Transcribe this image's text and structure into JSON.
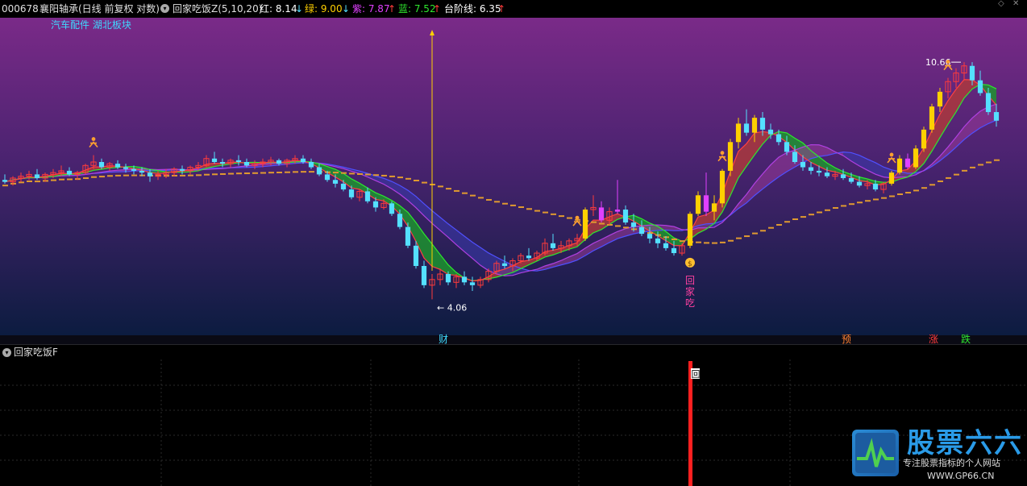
{
  "header": {
    "stock_code": "000678",
    "stock_name": "襄阳轴承",
    "period": "(日线 前复权 对数)",
    "indicator": "回家吃饭Z(5,10,20)",
    "red_label": "红: 8.14",
    "red_arrow": "↓",
    "green_label": "绿: 9.00",
    "green_arrow": "↓",
    "purple_label": "紫: 7.87",
    "purple_arrow": "↑",
    "blue_label": "蓝: 7.52",
    "blue_arrow": "↑",
    "step_label": "台阶线: 6.35",
    "step_arrow": "↑"
  },
  "sectors": "汽车配件 湖北板块",
  "sub_panel": {
    "title": "回家吃饭F",
    "mark": "回"
  },
  "watermark": {
    "title": "股票六六",
    "subtitle": "专注股票指标的个人网站",
    "url": "WWW.GP66.CN"
  },
  "colors": {
    "up": "#ff3b3b",
    "down": "#54e0ff",
    "yellow": "#ffd000",
    "magenta": "#e040ff",
    "green_line": "#2ee82e",
    "red_line": "#ff4040",
    "purple_line": "#b040e0",
    "blue_line": "#5050ff",
    "step": "#e09a30"
  },
  "chart_data": {
    "type": "candlestick",
    "scale": "log",
    "ylim": [
      3.6,
      12.2
    ],
    "max_label": "10.66",
    "min_label": "4.06",
    "annotations": {
      "signal_text": [
        "回",
        "家",
        "吃"
      ],
      "bottom_labels": [
        "财",
        "预",
        "涨",
        "跌"
      ]
    },
    "candles": [
      [
        6.6,
        6.75,
        6.5,
        6.55
      ],
      [
        6.55,
        6.7,
        6.45,
        6.65
      ],
      [
        6.65,
        6.8,
        6.55,
        6.7
      ],
      [
        6.7,
        6.85,
        6.6,
        6.75
      ],
      [
        6.75,
        6.9,
        6.6,
        6.65
      ],
      [
        6.65,
        6.8,
        6.55,
        6.75
      ],
      [
        6.75,
        6.9,
        6.65,
        6.8
      ],
      [
        6.8,
        7.0,
        6.7,
        6.85
      ],
      [
        6.85,
        6.95,
        6.7,
        6.75
      ],
      [
        6.75,
        6.85,
        6.6,
        6.8
      ],
      [
        6.8,
        7.05,
        6.75,
        7.0
      ],
      [
        7.0,
        7.3,
        6.9,
        7.1
      ],
      [
        7.1,
        7.2,
        6.9,
        6.95
      ],
      [
        6.95,
        7.1,
        6.85,
        7.05
      ],
      [
        7.05,
        7.15,
        6.9,
        6.95
      ],
      [
        6.95,
        7.05,
        6.8,
        6.9
      ],
      [
        6.9,
        7.0,
        6.75,
        6.85
      ],
      [
        6.85,
        6.95,
        6.7,
        6.8
      ],
      [
        6.8,
        6.9,
        6.55,
        6.7
      ],
      [
        6.7,
        6.85,
        6.6,
        6.75
      ],
      [
        6.75,
        6.9,
        6.65,
        6.8
      ],
      [
        6.8,
        6.95,
        6.7,
        6.9
      ],
      [
        6.9,
        7.0,
        6.75,
        6.85
      ],
      [
        6.85,
        7.0,
        6.75,
        6.95
      ],
      [
        6.95,
        7.1,
        6.85,
        7.0
      ],
      [
        7.0,
        7.3,
        6.95,
        7.2
      ],
      [
        7.2,
        7.4,
        7.05,
        7.1
      ],
      [
        7.1,
        7.2,
        6.95,
        7.05
      ],
      [
        7.05,
        7.2,
        6.95,
        7.15
      ],
      [
        7.15,
        7.3,
        7.0,
        7.1
      ],
      [
        7.1,
        7.2,
        6.95,
        7.0
      ],
      [
        7.0,
        7.15,
        6.9,
        7.05
      ],
      [
        7.05,
        7.2,
        6.95,
        7.1
      ],
      [
        7.1,
        7.25,
        7.0,
        7.15
      ],
      [
        7.15,
        7.2,
        7.0,
        7.05
      ],
      [
        7.05,
        7.2,
        6.95,
        7.15
      ],
      [
        7.15,
        7.3,
        7.05,
        7.2
      ],
      [
        7.2,
        7.3,
        7.05,
        7.1
      ],
      [
        7.1,
        7.2,
        6.9,
        6.95
      ],
      [
        6.95,
        7.05,
        6.7,
        6.75
      ],
      [
        6.75,
        6.85,
        6.55,
        6.6
      ],
      [
        6.6,
        6.75,
        6.4,
        6.5
      ],
      [
        6.5,
        6.6,
        6.3,
        6.35
      ],
      [
        6.35,
        6.45,
        6.1,
        6.15
      ],
      [
        6.15,
        6.35,
        6.05,
        6.3
      ],
      [
        6.3,
        6.4,
        6.0,
        6.05
      ],
      [
        6.05,
        6.15,
        5.8,
        5.9
      ],
      [
        5.9,
        6.1,
        5.85,
        6.0
      ],
      [
        6.0,
        6.05,
        5.7,
        5.75
      ],
      [
        5.75,
        5.85,
        5.4,
        5.45
      ],
      [
        5.45,
        5.55,
        5.0,
        5.05
      ],
      [
        5.05,
        5.15,
        4.6,
        4.65
      ],
      [
        4.65,
        4.75,
        4.25,
        4.3
      ],
      [
        4.3,
        4.5,
        4.06,
        4.4
      ],
      [
        4.4,
        4.6,
        4.3,
        4.5
      ],
      [
        4.5,
        4.55,
        4.3,
        4.35
      ],
      [
        4.35,
        4.5,
        4.25,
        4.45
      ],
      [
        4.45,
        4.55,
        4.3,
        4.35
      ],
      [
        4.35,
        4.45,
        4.2,
        4.3
      ],
      [
        4.3,
        4.45,
        4.25,
        4.4
      ],
      [
        4.4,
        4.6,
        4.35,
        4.55
      ],
      [
        4.55,
        4.75,
        4.5,
        4.7
      ],
      [
        4.7,
        4.85,
        4.6,
        4.65
      ],
      [
        4.65,
        4.8,
        4.55,
        4.75
      ],
      [
        4.75,
        4.9,
        4.7,
        4.85
      ],
      [
        4.85,
        5.0,
        4.75,
        4.8
      ],
      [
        4.8,
        4.95,
        4.75,
        4.9
      ],
      [
        4.9,
        5.2,
        4.85,
        5.1
      ],
      [
        5.1,
        5.3,
        4.95,
        5.0
      ],
      [
        5.0,
        5.15,
        4.9,
        5.05
      ],
      [
        5.05,
        5.2,
        4.95,
        5.15
      ],
      [
        5.15,
        5.3,
        5.05,
        5.2
      ],
      [
        5.2,
        5.9,
        5.15,
        5.85
      ],
      [
        5.85,
        6.2,
        5.7,
        5.9
      ],
      [
        5.9,
        6.05,
        5.55,
        5.6
      ],
      [
        5.6,
        5.9,
        5.5,
        5.8
      ],
      [
        5.8,
        6.6,
        5.75,
        5.85
      ],
      [
        5.85,
        5.95,
        5.5,
        5.55
      ],
      [
        5.55,
        5.75,
        5.35,
        5.45
      ],
      [
        5.45,
        5.6,
        5.25,
        5.3
      ],
      [
        5.3,
        5.45,
        5.1,
        5.2
      ],
      [
        5.2,
        5.35,
        5.0,
        5.1
      ],
      [
        5.1,
        5.25,
        4.95,
        5.0
      ],
      [
        5.0,
        5.15,
        4.85,
        4.9
      ],
      [
        4.9,
        5.1,
        4.85,
        5.05
      ],
      [
        5.05,
        5.8,
        5.0,
        5.75
      ],
      [
        5.75,
        6.3,
        5.7,
        6.2
      ],
      [
        6.2,
        6.8,
        5.7,
        5.8
      ],
      [
        5.8,
        6.2,
        5.6,
        6.0
      ],
      [
        6.0,
        6.9,
        5.9,
        6.85
      ],
      [
        6.85,
        7.8,
        6.7,
        7.7
      ],
      [
        7.7,
        8.5,
        7.5,
        8.3
      ],
      [
        8.3,
        8.8,
        7.9,
        8.0
      ],
      [
        8.0,
        8.6,
        7.7,
        8.5
      ],
      [
        8.5,
        8.7,
        7.9,
        8.1
      ],
      [
        8.1,
        8.3,
        7.8,
        7.95
      ],
      [
        7.95,
        8.1,
        7.6,
        7.7
      ],
      [
        7.7,
        7.9,
        7.3,
        7.4
      ],
      [
        7.4,
        7.6,
        7.05,
        7.1
      ],
      [
        7.1,
        7.3,
        6.85,
        6.95
      ],
      [
        6.95,
        7.1,
        6.75,
        6.85
      ],
      [
        6.85,
        7.0,
        6.7,
        6.8
      ],
      [
        6.8,
        6.95,
        6.65,
        6.7
      ],
      [
        6.7,
        6.85,
        6.6,
        6.75
      ],
      [
        6.75,
        6.9,
        6.6,
        6.65
      ],
      [
        6.65,
        6.8,
        6.5,
        6.55
      ],
      [
        6.55,
        6.7,
        6.4,
        6.45
      ],
      [
        6.45,
        6.6,
        6.35,
        6.5
      ],
      [
        6.5,
        6.6,
        6.3,
        6.35
      ],
      [
        6.35,
        6.55,
        6.25,
        6.5
      ],
      [
        6.5,
        6.85,
        6.45,
        6.8
      ],
      [
        6.8,
        7.3,
        6.75,
        7.2
      ],
      [
        7.2,
        7.35,
        6.9,
        6.95
      ],
      [
        6.95,
        7.6,
        6.9,
        7.5
      ],
      [
        7.5,
        8.2,
        7.4,
        8.1
      ],
      [
        8.1,
        9.0,
        8.0,
        8.9
      ],
      [
        8.9,
        9.6,
        8.7,
        9.45
      ],
      [
        9.45,
        10.0,
        9.2,
        9.85
      ],
      [
        9.85,
        10.4,
        9.6,
        10.2
      ],
      [
        10.2,
        10.66,
        9.9,
        10.5
      ],
      [
        10.5,
        10.66,
        9.7,
        9.9
      ],
      [
        9.9,
        10.3,
        9.3,
        9.4
      ],
      [
        9.4,
        9.6,
        8.6,
        8.7
      ],
      [
        8.7,
        9.0,
        8.2,
        8.4
      ]
    ]
  }
}
